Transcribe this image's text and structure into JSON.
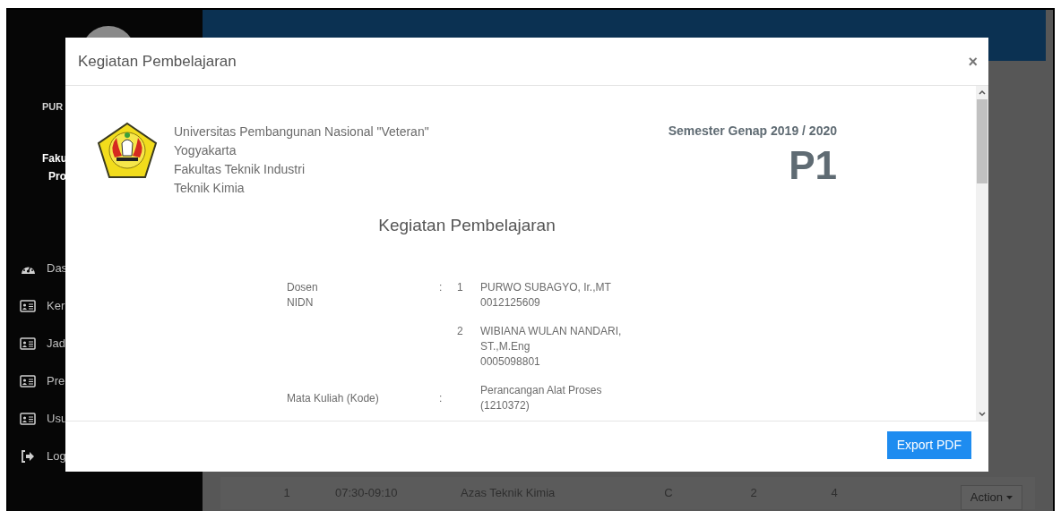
{
  "background": {
    "sidebar": {
      "user_name": "PUR",
      "faculty": "Faku",
      "program": "Pro",
      "menu": [
        {
          "label": "Das",
          "kind": "dashboard"
        },
        {
          "label": "Ker",
          "kind": "card"
        },
        {
          "label": "Jad",
          "kind": "card"
        },
        {
          "label": "Pre",
          "kind": "card"
        },
        {
          "label": "Usu",
          "kind": "card"
        },
        {
          "label": "Log",
          "kind": "logout"
        }
      ]
    },
    "table_row": {
      "cells": [
        "1",
        "07:30-09:10",
        "Azas Teknik Kimia",
        "C",
        "2",
        "4"
      ],
      "action": "Action"
    }
  },
  "modal": {
    "title": "Kegiatan Pembelajaran",
    "close": "×",
    "university_lines": [
      "Universitas Pembangunan Nasional \"Veteran\"",
      "Yogyakarta",
      "Fakultas Teknik Industri",
      "Teknik Kimia"
    ],
    "semester": "Semester Genap 2019 / 2020",
    "code": "P1",
    "heading": "Kegiatan Pembelajaran",
    "lecturer_label": "Dosen",
    "nidn_label": "NIDN",
    "lecturer_separator": ":",
    "lecturers": [
      {
        "number": "1",
        "name": "PURWO SUBAGYO, Ir.,MT",
        "nidn": "0012125609"
      },
      {
        "number": "2",
        "name": "WIBIANA WULAN NANDARI, ST.,M.Eng",
        "nidn": "0005098801"
      }
    ],
    "course_label": "Mata Kuliah (Kode)",
    "course_separator": ":",
    "course": "Perancangan Alat Proses (1210372)",
    "export_button": "Export PDF"
  }
}
